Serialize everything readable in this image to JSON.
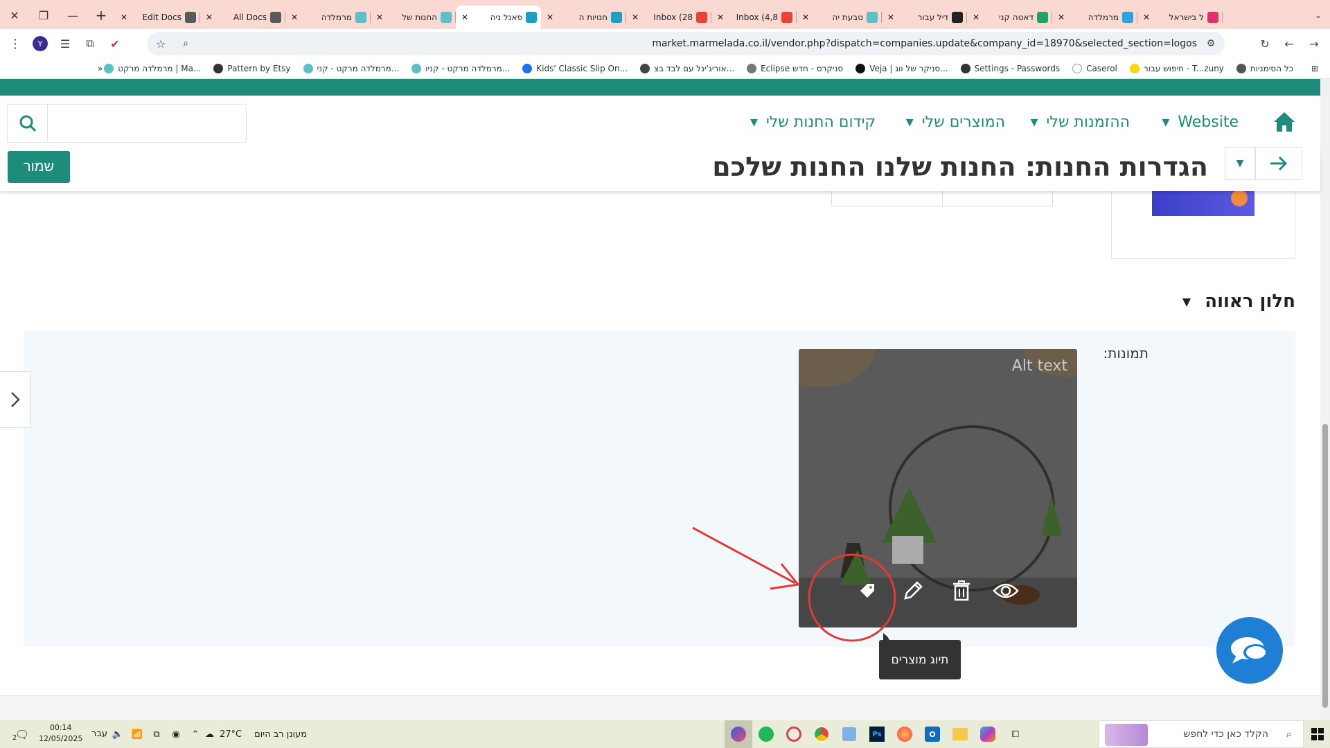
{
  "browser": {
    "tabs": [
      {
        "title": "Edit Docs",
        "fav": "#5a5a5a"
      },
      {
        "title": "All Docs",
        "fav": "#5a5a5a"
      },
      {
        "title": "מרמלדה",
        "fav": "#5bc0c9"
      },
      {
        "title": "החנות של",
        "fav": "#5bc0c9"
      },
      {
        "title": "פאנל ניה",
        "fav": "#1aa0c4",
        "active": true
      },
      {
        "title": "חנויות ה",
        "fav": "#1aa0c4"
      },
      {
        "title": "Inbox (28",
        "fav": "#ea4335"
      },
      {
        "title": "Inbox (4,8",
        "fav": "#ea4335"
      },
      {
        "title": "טבעת יה",
        "fav": "#5bc0c9"
      },
      {
        "title": "דיל עבור",
        "fav": "#222222"
      },
      {
        "title": "דאטה קני",
        "fav": "#21a366"
      },
      {
        "title": "מרמלדה",
        "fav": "#2aa3e0"
      },
      {
        "title": "ל בישראל",
        "fav": "#e1306c"
      }
    ],
    "url": "market.marmelada.co.il/vendor.php?dispatch=companies.update&company_id=18970&selected_section=logos",
    "profile_initial": "Y",
    "bookmarks": [
      {
        "label": "כל הסימניות",
        "fav": "#555555"
      },
      {
        "label": "חיפוש עבור - T...zuny",
        "fav": "#f5d90a"
      },
      {
        "label": "Caserol",
        "fav": "#ffffff"
      },
      {
        "label": "Settings - Passwords",
        "fav": "#333333"
      },
      {
        "label": "Veja | סניקר של ווג...",
        "fav": "#111111"
      },
      {
        "label": "Eclipse סניקרס - חדש",
        "fav": "#777777"
      },
      {
        "label": "אוריג'ינל עם לבד בצ...",
        "fav": "#444444"
      },
      {
        "label": "Kids' Classic Slip On...",
        "fav": "#1a73e8"
      },
      {
        "label": "מרמלדה מרקט - קניו...",
        "fav": "#5bc0c9"
      },
      {
        "label": "מרמלדה מרקט - קני...",
        "fav": "#5bc0c9"
      },
      {
        "label": "Pattern by Etsy",
        "fav": "#333333"
      },
      {
        "label": "מרמלדה מרקט | Ma...",
        "fav": "#5bc0c9"
      }
    ]
  },
  "nav": {
    "website": "Website",
    "orders": "ההזמנות שלי",
    "products": "המוצרים שלי",
    "promo": "קידום החנות שלי",
    "search_placeholder": ""
  },
  "page": {
    "save": "שמור",
    "title": "הגדרות החנות: החנות שלנו החנות שלכם",
    "section": "חלון ראווה",
    "images_label": "תמונות:",
    "alt_text": "Alt text",
    "tooltip": "תיוג מוצרים"
  },
  "taskbar": {
    "search_placeholder": "הקלד כאן כדי לחפש",
    "weather": "27°C",
    "weather_desc": "מעונן רב היום",
    "language": "עבר",
    "time": "00:14",
    "date": "12/05/2025",
    "notif_count": "2"
  },
  "colors": {
    "brand": "#1e8c7b",
    "annotation": "#e53935",
    "chat": "#1e7fd4"
  }
}
